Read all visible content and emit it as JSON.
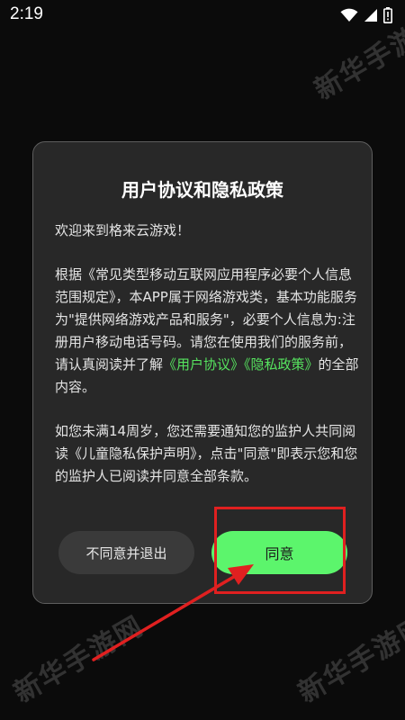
{
  "status_bar": {
    "time": "2:19",
    "icons": [
      "wifi-icon",
      "signal-icon",
      "battery-alert-icon"
    ]
  },
  "watermark": {
    "text": "新华手游网",
    "color": "#ffffff"
  },
  "dialog": {
    "title": "用户协议和隐私政策",
    "greeting": "欢迎来到格来云游戏！",
    "para1_text": "根据《常见类型移动互联网应用程序必要个人信息范围规定》，本APP属于网络游戏类，基本功能服务为\"提供网络游戏产品和服务\"，必要个人信息为:注册用户移动电话号码。请您在使用我们的服务前，请认真阅读并了解",
    "link_user_agreement": "《用户协议》",
    "link_privacy_policy": "《隐私政策》",
    "para1_suffix": "的全部内容。",
    "para2_text": "如您未满14周岁，您还需要通知您的监护人共同阅读《儿童隐私保护声明》，点击\"同意\"即表示您和您的监护人已阅读并同意全部条款。",
    "decline_label": "不同意并退出",
    "agree_label": "同意"
  },
  "colors": {
    "accent": "#5cf56c",
    "link": "#56e35f",
    "annotation": "#e02020",
    "dialog_bg": "#282828"
  }
}
